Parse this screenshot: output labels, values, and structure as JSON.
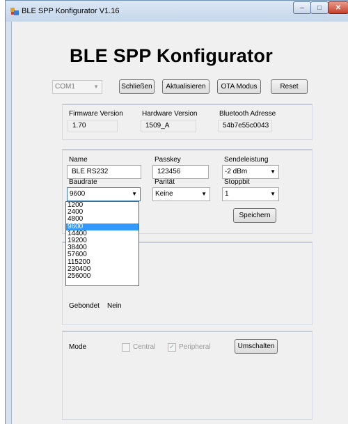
{
  "window": {
    "title": "BLE SPP Konfigurator V1.16",
    "minimize_glyph": "–",
    "maximize_glyph": "□",
    "close_glyph": "✕"
  },
  "header": {
    "title": "BLE SPP Konfigurator"
  },
  "toolbar": {
    "port_value": "COM1",
    "close_label": "Schließen",
    "refresh_label": "Aktualisieren",
    "ota_label": "OTA Modus",
    "reset_label": "Reset"
  },
  "device_info": {
    "firmware_label": "Firmware Version",
    "firmware_value": "1.70",
    "hardware_label": "Hardware Version",
    "hardware_value": "1509_A",
    "bt_label": "Bluetooth Adresse",
    "bt_value": "54b7e55c0043"
  },
  "settings": {
    "name_label": "Name",
    "name_value": "BLE RS232",
    "passkey_label": "Passkey",
    "passkey_value": "123456",
    "power_label": "Sendeleistung",
    "power_value": "-2 dBm",
    "baud_label": "Baudrate",
    "baud_value": "9600",
    "parity_label": "Parität",
    "parity_value": "Keine",
    "stopbit_label": "Stoppbit",
    "stopbit_value": "1",
    "save_label": "Speichern",
    "baud_options": [
      "1200",
      "2400",
      "4800",
      "9600",
      "14400",
      "19200",
      "38400",
      "57600",
      "115200",
      "230400",
      "256000"
    ],
    "baud_selected_index": 3
  },
  "bonding": {
    "label": "Gebondet",
    "value": "Nein"
  },
  "mode": {
    "label": "Mode",
    "central_label": "Central",
    "central_checked": false,
    "peripheral_label": "Peripheral",
    "peripheral_checked": true,
    "switch_label": "Umschalten"
  },
  "colors": {
    "selection": "#3399ff",
    "title_bar": "#c5d6eb",
    "close_button": "#c7402a"
  }
}
